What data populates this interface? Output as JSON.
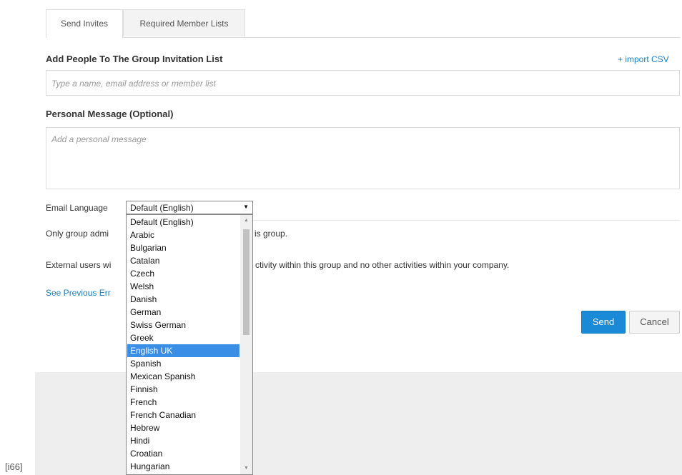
{
  "tabs": [
    {
      "label": "Send Invites",
      "active": true
    },
    {
      "label": "Required Member Lists",
      "active": false
    }
  ],
  "add_people": {
    "heading": "Add People To The Group Invitation List",
    "import_link": "+ import CSV",
    "placeholder": "Type a name, email address or member list"
  },
  "personal_message": {
    "heading": "Personal Message (Optional)",
    "placeholder": "Add a personal message"
  },
  "email_language": {
    "label": "Email Language",
    "selected": "Default (English)",
    "options": [
      "Default (English)",
      "Arabic",
      "Bulgarian",
      "Catalan",
      "Czech",
      "Welsh",
      "Danish",
      "German",
      "Swiss German",
      "Greek",
      "English UK",
      "Spanish",
      "Mexican Spanish",
      "Finnish",
      "French",
      "French Canadian",
      "Hebrew",
      "Hindi",
      "Croatian",
      "Hungarian"
    ],
    "highlighted": "English UK"
  },
  "info": {
    "line1_prefix": "Only group admi",
    "line1_suffix": "is group.",
    "line2_prefix": "External users wi",
    "line2_suffix": "ctivity within this group and no other activities within your company.",
    "previous_link": "See Previous Err"
  },
  "buttons": {
    "send": "Send",
    "cancel": "Cancel"
  },
  "corner_label": "[i66]",
  "colors": {
    "primary": "#1b8ad6",
    "link": "#1a7fc4",
    "highlight": "#3a8ee6"
  }
}
